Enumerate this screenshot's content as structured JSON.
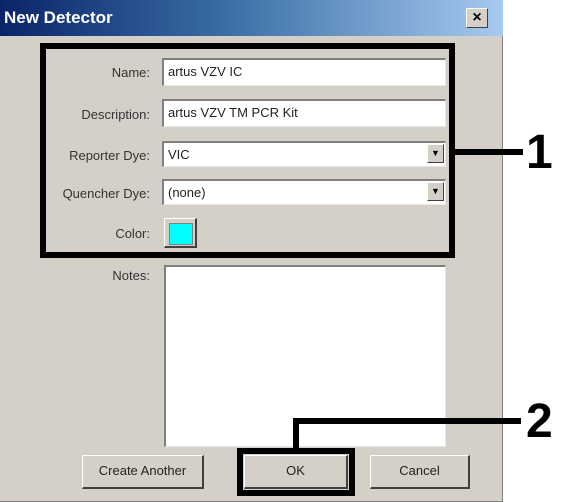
{
  "dialog": {
    "title": "New Detector",
    "close_label": "×"
  },
  "form": {
    "name_label": "Name:",
    "name_value": "artus VZV IC",
    "description_label": "Description:",
    "description_value": "artus VZV TM PCR Kit",
    "reporter_label": "Reporter Dye:",
    "reporter_value": "VIC",
    "quencher_label": "Quencher Dye:",
    "quencher_value": "(none)",
    "color_label": "Color:",
    "color_value": "#00ffff",
    "notes_label": "Notes:",
    "notes_value": ""
  },
  "buttons": {
    "create_another": "Create Another",
    "ok": "OK",
    "cancel": "Cancel"
  },
  "annotations": {
    "callout_1": "1",
    "callout_2": "2"
  },
  "icons": {
    "dropdown": "▼"
  }
}
